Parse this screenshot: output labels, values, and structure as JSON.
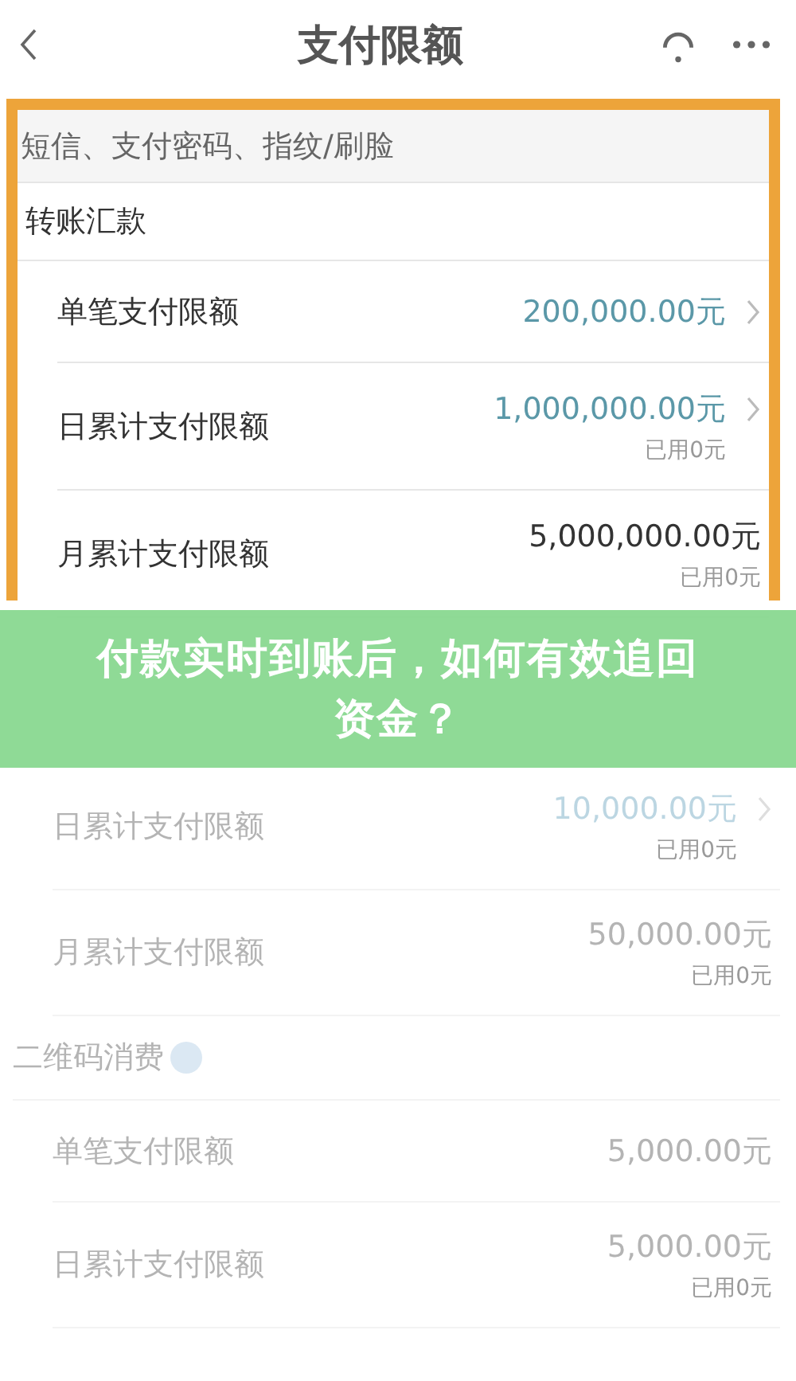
{
  "header": {
    "title": "支付限额"
  },
  "highlighted_section": {
    "auth_note": "短信、支付密码、指纹/刷脸",
    "title": "转账汇款",
    "rows": [
      {
        "label": "单笔支付限额",
        "value": "200,000.00元",
        "kind": "link"
      },
      {
        "label": "日累计支付限额",
        "value": "1,000,000.00元",
        "used": "已用0元",
        "kind": "link"
      },
      {
        "label": "月累计支付限额",
        "value": "5,000,000.00元",
        "used": "已用0元",
        "kind": "plain"
      }
    ]
  },
  "banner": {
    "text": "付款实时到账后，如何有效追回资金？"
  },
  "faded_sections": [
    {
      "rows": [
        {
          "label": "日累计支付限额",
          "value": "10,000.00元",
          "used": "已用0元",
          "kind": "link"
        },
        {
          "label": "月累计支付限额",
          "value": "50,000.00元",
          "used": "已用0元",
          "kind": "plain"
        }
      ]
    },
    {
      "title": "二维码消费",
      "info": true,
      "rows": [
        {
          "label": "单笔支付限额",
          "value": "5,000.00元",
          "kind": "plain"
        },
        {
          "label": "日累计支付限额",
          "value": "5,000.00元",
          "used": "已用0元",
          "kind": "plain"
        }
      ]
    }
  ]
}
